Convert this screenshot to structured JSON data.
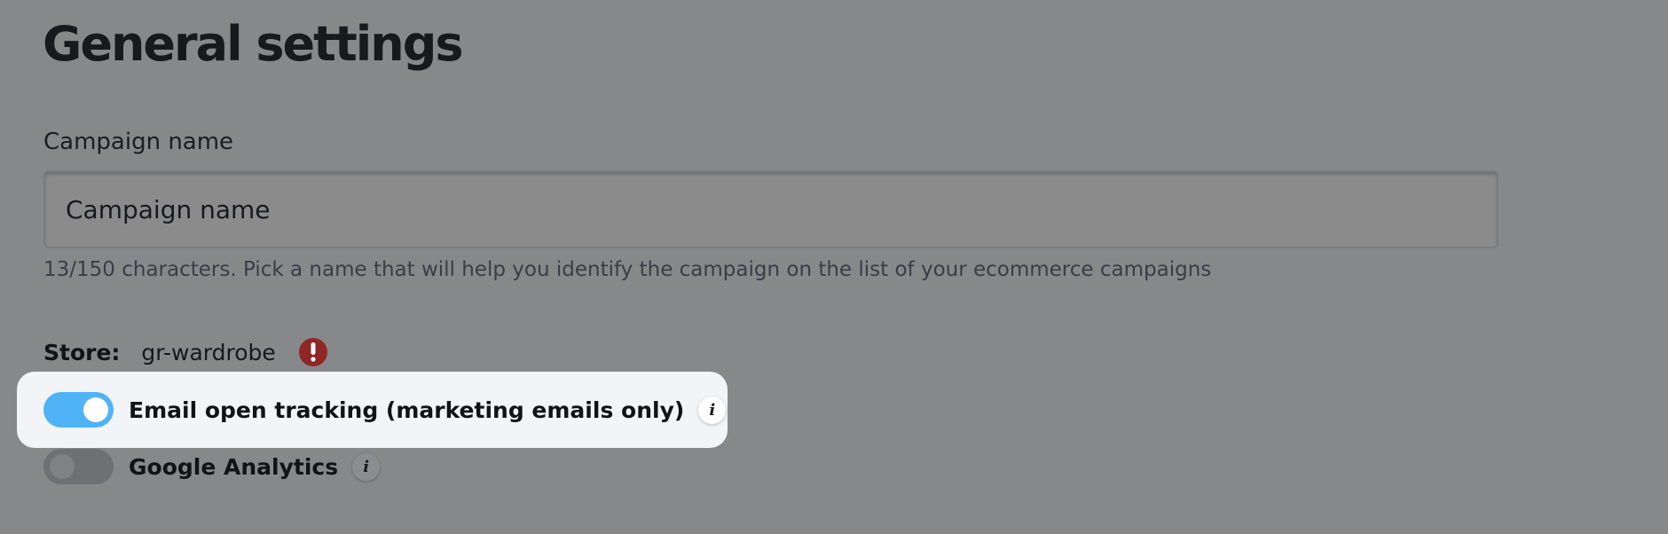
{
  "page": {
    "title": "General settings"
  },
  "campaign_name": {
    "label": "Campaign name",
    "value": "Campaign name",
    "hint": "13/150 characters. Pick a name that will help you identify the campaign on the list of your ecommerce campaigns"
  },
  "store": {
    "label": "Store:",
    "value": "gr-wardrobe",
    "alert_icon": "exclamation-circle-icon",
    "alert_color": "#8e2725"
  },
  "toggles": [
    {
      "label": "Email open tracking (marketing emails only)",
      "state": "on",
      "highlighted": true,
      "info_icon": "info-icon"
    },
    {
      "label": "Google Analytics",
      "state": "off",
      "highlighted": false,
      "info_icon": "info-icon"
    }
  ],
  "colors": {
    "overlay_background": "#87888a",
    "toggle_on": "#4fb3f5",
    "highlight_card": "#f3f4f8"
  }
}
